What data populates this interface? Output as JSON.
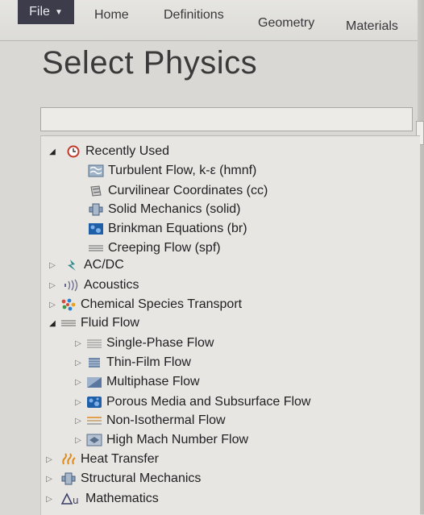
{
  "ribbon": {
    "file_label": "File",
    "tabs": [
      "Home",
      "Definitions",
      "Geometry",
      "Materials"
    ]
  },
  "page": {
    "title": "Select Physics",
    "search_value": ""
  },
  "tree": {
    "recently_used": {
      "label": "Recently Used",
      "items": [
        "Turbulent Flow, k-ε (hmnf)",
        "Curvilinear Coordinates (cc)",
        "Solid Mechanics (solid)",
        "Brinkman Equations (br)",
        "Creeping Flow (spf)"
      ]
    },
    "acdc": "AC/DC",
    "acoustics": "Acoustics",
    "chemical": "Chemical Species Transport",
    "fluid_flow": {
      "label": "Fluid Flow",
      "items": [
        "Single-Phase Flow",
        "Thin-Film Flow",
        "Multiphase Flow",
        "Porous Media and Subsurface Flow",
        "Non-Isothermal Flow",
        "High Mach Number Flow"
      ]
    },
    "heat_transfer": "Heat Transfer",
    "structural": "Structural Mechanics",
    "mathematics": "Mathematics"
  },
  "colors": {
    "file_button": "#3c3c4a",
    "recent_icon": "#c0392b",
    "acdc_icon": "#2e8b8b",
    "heat_icon": "#e08a1e",
    "porous_icon": "#1f5fa8"
  }
}
